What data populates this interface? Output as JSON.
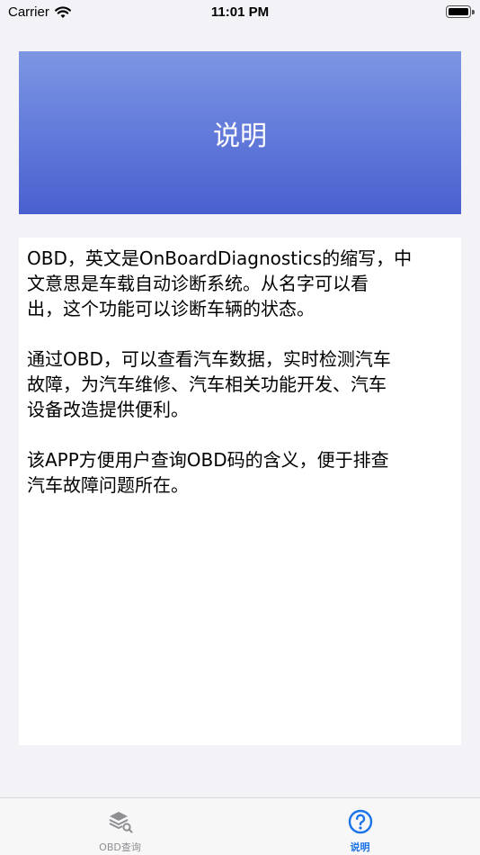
{
  "status_bar": {
    "carrier": "Carrier",
    "time": "11:01 PM"
  },
  "header": {
    "title": "说明"
  },
  "content": {
    "paragraphs": [
      "OBD，英文是OnBoardDiagnostics的缩写，中\n文意思是车载自动诊断系统。从名字可以看\n出，这个功能可以诊断车辆的状态。",
      "通过OBD，可以查看汽车数据，实时检测汽车\n故障，为汽车维修、汽车相关功能开发、汽车\n设备改造提供便利。",
      "该APP方便用户查询OBD码的含义，便于排查\n汽车故障问题所在。"
    ]
  },
  "tabs": [
    {
      "label": "OBD查询",
      "icon": "layers-search-icon",
      "active": false
    },
    {
      "label": "说明",
      "icon": "question-circle-icon",
      "active": true
    }
  ],
  "colors": {
    "accent": "#1a73e8",
    "banner_top": "#7d96e3",
    "banner_bottom": "#4a5fcf",
    "tab_inactive": "#8e8e93"
  }
}
